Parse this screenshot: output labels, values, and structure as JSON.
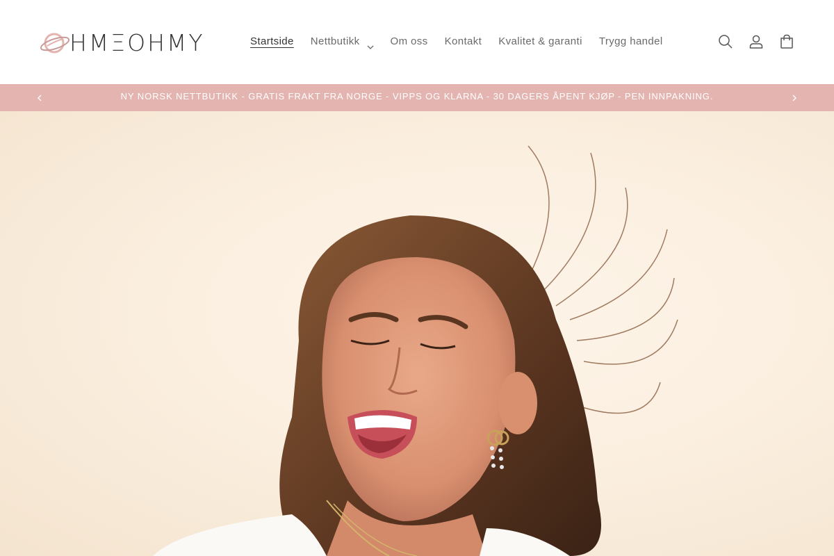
{
  "brand": {
    "logo_text": "HMΞOHMY",
    "logo_icon": "planet-icon"
  },
  "nav": {
    "items": [
      {
        "label": "Startside",
        "active": true
      },
      {
        "label": "Nettbutikk",
        "has_dropdown": true
      },
      {
        "label": "Om oss"
      },
      {
        "label": "Kontakt"
      },
      {
        "label": "Kvalitet & garanti"
      },
      {
        "label": "Trygg handel"
      }
    ]
  },
  "header_icons": [
    "search-icon",
    "account-icon",
    "cart-icon"
  ],
  "announcement": {
    "text": "NY NORSK NETTBUTIKK - GRATIS FRAKT FRA NORGE - VIPPS OG KLARNA - 30 DAGERS ÅPENT KJØP - PEN INNPAKNING.",
    "background": "#e4b4b0",
    "prev_icon": "chevron-left-icon",
    "next_icon": "chevron-right-icon"
  },
  "hero": {
    "image": "photo of a laughing young woman with windswept hair wearing hoop earrings",
    "background": "#fbefe0"
  }
}
